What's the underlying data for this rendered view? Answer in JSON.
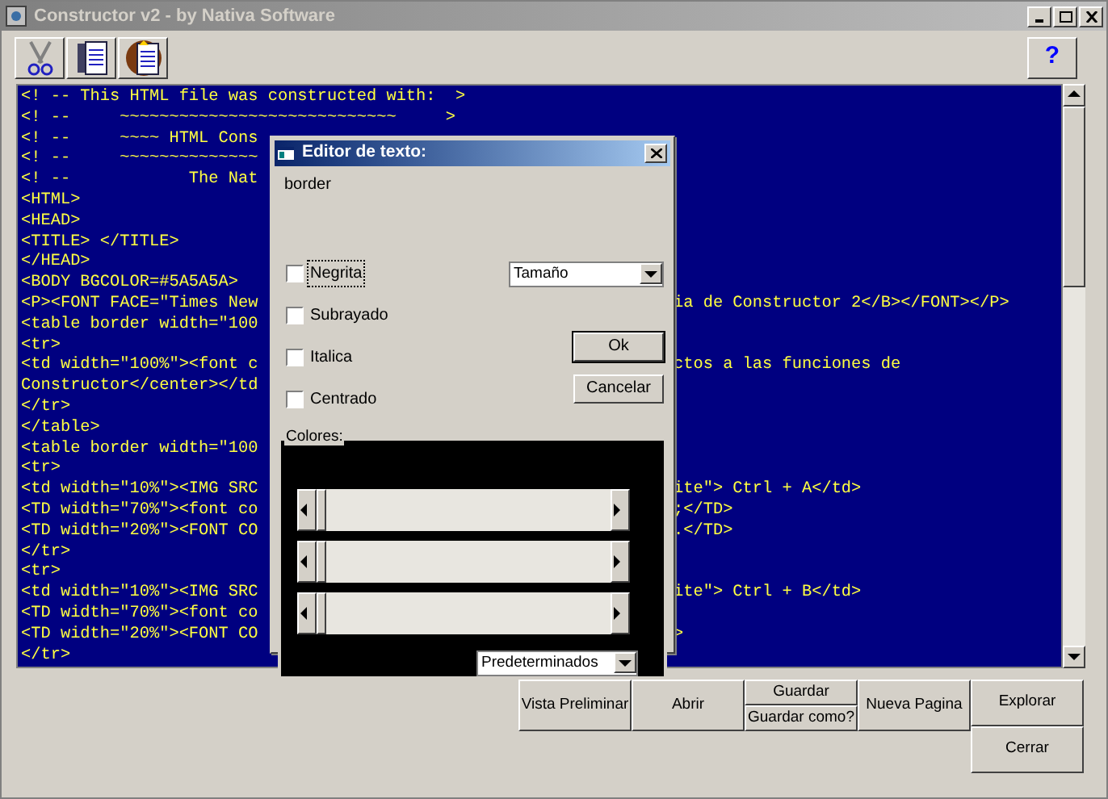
{
  "window": {
    "title": "Constructor v2 - by Nativa Software"
  },
  "toolbar": {
    "help": "?"
  },
  "editor": {
    "lines": [
      {
        "text": "<! -- This HTML file was constructed with:  >"
      },
      {
        "text": "<! --     ~~~~~~~~~~~~~~~~~~~~~~~~~~~~     >"
      },
      {
        "left": "<! --     ~~~~ HTML Cons"
      },
      {
        "left": "<! --     ~~~~~~~~~~~~~~"
      },
      {
        "left": "<! --            The Nat"
      },
      {
        "left": "<HTML>"
      },
      {
        "left": "<HEAD>"
      },
      {
        "left": "<TITLE> </TITLE>"
      },
      {
        "left": "</HEAD>"
      },
      {
        "left": "<BODY BGCOLOR=#5A5A5A>"
      },
      {
        "left": "<P><FONT FACE=\"Times New",
        "right": "ia de Constructor 2</B></FONT></P>"
      },
      {
        "left": "<table border width=\"100"
      },
      {
        "left": "<tr>"
      },
      {
        "left": "<td width=\"100%\"><font c",
        "right": "ctos a las funciones de"
      },
      {
        "left": "Constructor</center></td"
      },
      {
        "left": "</tr>"
      },
      {
        "left": "</table>"
      },
      {
        "left": "<table border width=\"100"
      },
      {
        "left": "<tr>"
      },
      {
        "left": "<td width=\"10%\"><IMG SRC",
        "right": "ite\"> Ctrl + A</td>"
      },
      {
        "left": "<TD width=\"70%\"><font co",
        "right": ";</TD>"
      },
      {
        "left": "<TD width=\"20%\"><FONT CO",
        "right": ".</TD>"
      },
      {
        "left": "</tr>"
      },
      {
        "left": "<tr>"
      },
      {
        "left": "<td width=\"10%\"><IMG SRC",
        "right": "ite\"> Ctrl + B</td>"
      },
      {
        "left": "<TD width=\"70%\"><font co"
      },
      {
        "left": "<TD width=\"20%\"><FONT CO",
        "right": ">"
      },
      {
        "left": "</tr>"
      }
    ]
  },
  "dialog": {
    "title": "Editor de texto:",
    "preview": "border",
    "options": [
      {
        "label": "Negrita",
        "checked": false,
        "focused": true
      },
      {
        "label": "Subrayado",
        "checked": false,
        "focused": false
      },
      {
        "label": "Italica",
        "checked": false,
        "focused": false
      },
      {
        "label": "Centrado",
        "checked": false,
        "focused": false
      }
    ],
    "size_select": "Tamaño",
    "ok": "Ok",
    "cancel": "Cancelar",
    "colors": {
      "label": "Colores:",
      "sliders": [
        {
          "level": 0
        },
        {
          "level": 0
        },
        {
          "level": 0
        }
      ],
      "preset": "Predeterminados"
    }
  },
  "buttons": [
    {
      "kind": "single",
      "labels": [
        "Vista Preliminar"
      ]
    },
    {
      "kind": "single",
      "labels": [
        "Abrir"
      ]
    },
    {
      "kind": "stack",
      "labels": [
        "Guardar",
        "Guardar como?"
      ]
    },
    {
      "kind": "single",
      "labels": [
        "Nueva Pagina"
      ]
    }
  ],
  "side_buttons": [
    "Explorar",
    "Cerrar"
  ]
}
